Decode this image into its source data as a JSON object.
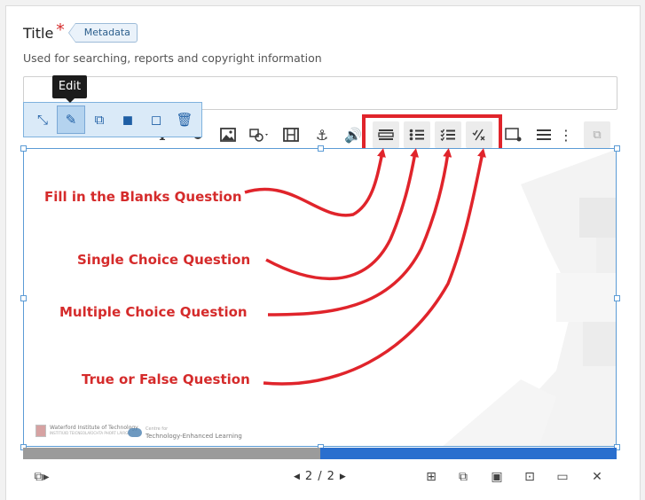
{
  "form": {
    "title_label": "Title",
    "required_mark": "*",
    "metadata_badge": "Metadata",
    "hint": "Used for searching, reports and copyright information",
    "title_value": ""
  },
  "tooltip": {
    "text": "Edit"
  },
  "edit_toolbar": {
    "buttons": [
      {
        "icon": "expand-icon"
      },
      {
        "icon": "pencil-icon",
        "active": true
      },
      {
        "icon": "copy-icon"
      },
      {
        "icon": "bring-forward-icon"
      },
      {
        "icon": "send-backward-icon"
      },
      {
        "icon": "trash-icon"
      }
    ]
  },
  "content_toolbar": {
    "buttons": [
      {
        "icon": "text-icon"
      },
      {
        "icon": "link-icon"
      },
      {
        "icon": "image-icon"
      },
      {
        "icon": "shapes-dropdown-icon"
      },
      {
        "icon": "video-icon"
      },
      {
        "icon": "anchor-icon"
      },
      {
        "icon": "audio-icon"
      },
      {
        "icon": "fill-in-blanks-icon"
      },
      {
        "icon": "single-choice-icon"
      },
      {
        "icon": "multiple-choice-icon"
      },
      {
        "icon": "true-false-icon"
      },
      {
        "icon": "summary-icon"
      },
      {
        "icon": "list-icon"
      },
      {
        "icon": "more-icon"
      },
      {
        "icon": "paste-icon"
      }
    ]
  },
  "annotations": {
    "fill_blanks": "Fill in the Blanks Question",
    "single_choice": "Single Choice Question",
    "multiple_choice": "Multiple Choice Question",
    "true_false": "True or False Question"
  },
  "logos": {
    "wit_line1": "Waterford Institute of Technology",
    "wit_line2": "INSTITIÚID TEICNEOLAÍOCHTA PHORT LÁIRGE",
    "centre_line1": "Centre for",
    "centre_line2": "Technology-Enhanced Learning"
  },
  "progress": {
    "fraction": 0.5
  },
  "footer": {
    "current_page": "2",
    "separator": "/",
    "total_pages": "2",
    "icons": [
      "slide-layout-icon",
      "add-slide-icon",
      "clone-slide-icon",
      "slide-background-icon",
      "keyword-icon",
      "sort-slides-icon",
      "delete-slide-icon"
    ]
  },
  "colors": {
    "annotation_red": "#e0242b",
    "accent_blue": "#2a6fce",
    "edit_bar_bg": "#daeaf8"
  }
}
